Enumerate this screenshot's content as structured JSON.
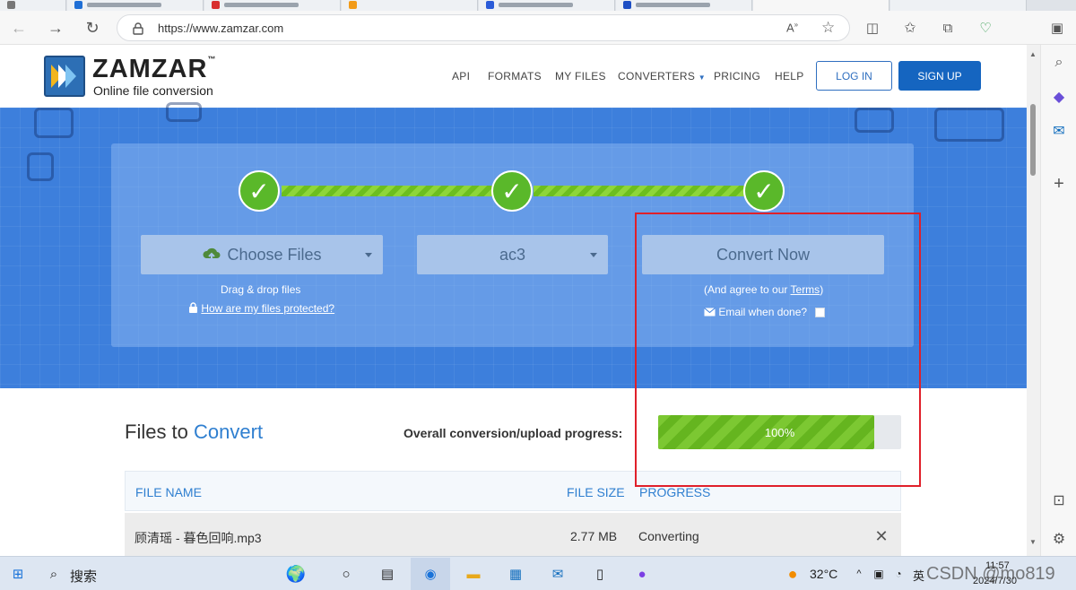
{
  "browser": {
    "url": "https://www.zamzar.com",
    "icons": [
      "back-icon",
      "forward-icon",
      "refresh-icon",
      "lock-icon",
      "read-aloud-icon",
      "favorite-star-icon",
      "split-screen-icon",
      "favorites-icon",
      "collections-icon",
      "browser-essentials-icon",
      "sidebar-toggle-icon"
    ]
  },
  "sidebar": {
    "icons": [
      "search-icon",
      "copilot-icon",
      "outlook-icon",
      "add-icon",
      "screenshot-icon",
      "settings-icon"
    ]
  },
  "header": {
    "logo_name": "ZAMZAR",
    "logo_tm": "™",
    "logo_tagline": "Online file conversion",
    "nav": [
      "API",
      "FORMATS",
      "MY FILES",
      "CONVERTERS",
      "PRICING",
      "HELP"
    ],
    "login_label": "LOG IN",
    "signup_label": "SIGN UP"
  },
  "converter": {
    "step_check": "✓",
    "choose_files_label": "Choose Files",
    "drag_drop_text": "Drag & drop files",
    "protected_link": "How are my files protected?",
    "format_value": "ac3",
    "convert_label": "Convert Now",
    "agree_prefix": "(And agree to our ",
    "terms_link": "Terms",
    "agree_suffix": ")",
    "email_label": "Email when done?",
    "email_checked": false
  },
  "files": {
    "title_plain": "Files to ",
    "title_highlight": "Convert",
    "progress_label": "Overall conversion/upload progress:",
    "progress_text": "100%",
    "progress_fraction": 0.89,
    "columns": [
      "FILE NAME",
      "FILE SIZE",
      "PROGRESS"
    ],
    "rows": [
      {
        "name": "顾清瑶 - 暮色回响.mp3",
        "size": "2.77 MB",
        "status": "Converting",
        "remove": "✕"
      }
    ]
  },
  "taskbar": {
    "search_label": "搜索",
    "weather": "32°C",
    "lang": "英",
    "time": "11:57",
    "date": "2024/7/30",
    "watermark": "CSDN @mo819"
  },
  "colors": {
    "brand_blue": "#1565c0",
    "hero_blue": "#3d7fdc",
    "success_green": "#5ab82a",
    "annotation_red": "#e0202a"
  }
}
